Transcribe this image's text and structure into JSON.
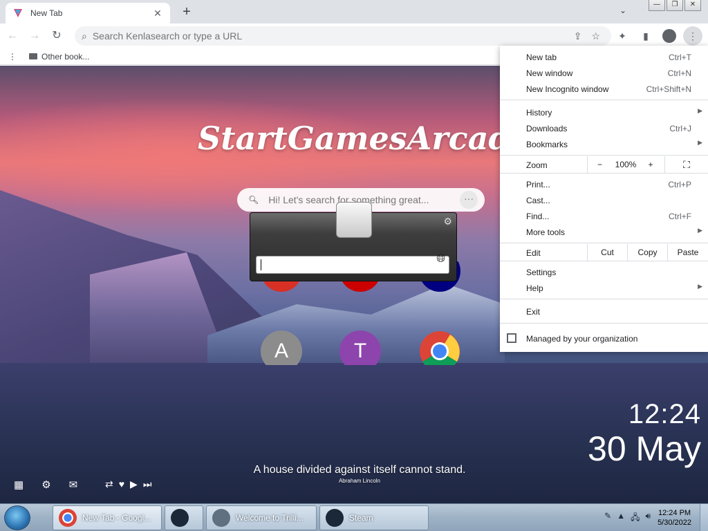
{
  "browser": {
    "tab_title": "New Tab",
    "tab_close": "✕",
    "new_tab": "+",
    "tab_search": "⌄",
    "win_min": "—",
    "win_restore": "❐",
    "win_close": "✕",
    "omnibox_placeholder": "Search Kenlasearch or type a URL",
    "bookmarks_other": "Other book..."
  },
  "page": {
    "brand": "StartGamesArcadeSe",
    "search_placeholder": "Hi! Let's search for something great...",
    "search_more": "···",
    "shortcuts": [
      {
        "letter": "A",
        "color": "#8c8c8c"
      },
      {
        "letter": "T",
        "color": "#8e44ad"
      }
    ],
    "quote_text": "A house divided against itself cannot stand.",
    "quote_author": "Abraham Lincoln",
    "clock_time": "12:24",
    "clock_date": "30 May"
  },
  "menu": {
    "new_tab": "New tab",
    "new_tab_sc": "Ctrl+T",
    "new_window": "New window",
    "new_window_sc": "Ctrl+N",
    "incognito": "New Incognito window",
    "incognito_sc": "Ctrl+Shift+N",
    "history": "History",
    "downloads": "Downloads",
    "downloads_sc": "Ctrl+J",
    "bookmarks": "Bookmarks",
    "zoom": "Zoom",
    "zoom_minus": "−",
    "zoom_value": "100%",
    "zoom_plus": "+",
    "print": "Print...",
    "print_sc": "Ctrl+P",
    "cast": "Cast...",
    "find": "Find...",
    "find_sc": "Ctrl+F",
    "more_tools": "More tools",
    "edit": "Edit",
    "cut": "Cut",
    "copy": "Copy",
    "paste": "Paste",
    "settings": "Settings",
    "help": "Help",
    "exit": "Exit",
    "managed": "Managed by your organization"
  },
  "taskbar": {
    "items": [
      {
        "label": "New Tab - Googl...",
        "color": "#db4437"
      },
      {
        "label": "",
        "color": "#1b2838"
      },
      {
        "label": "Welcome to Trilli...",
        "color": "#607080"
      },
      {
        "label": "Steam",
        "color": "#1b2838"
      }
    ],
    "time": "12:24 PM",
    "date": "5/30/2022"
  },
  "colors": {
    "accent": "#1a73e8",
    "menu_bg": "#ffffff",
    "taskbar": "#9eb2c6"
  }
}
